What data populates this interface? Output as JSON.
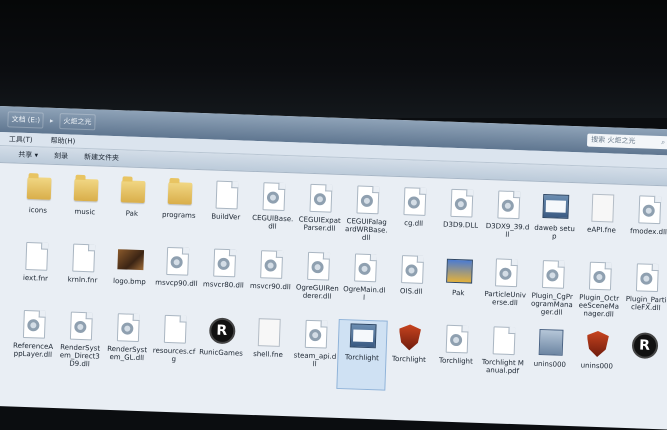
{
  "address": {
    "crumbs": [
      "文档 (E:)",
      "火炬之光"
    ],
    "separator": "▸"
  },
  "search": {
    "placeholder": "搜索 火炬之光"
  },
  "menu": {
    "items": [
      "工具(T)",
      "帮助(H)"
    ]
  },
  "toolbar": {
    "items": [
      "共享 ▾",
      "刻录",
      "新建文件夹"
    ]
  },
  "files": [
    {
      "name": "icons",
      "icon": "folder-icon"
    },
    {
      "name": "music",
      "icon": "folder-icon"
    },
    {
      "name": "Pak",
      "icon": "folder-icon"
    },
    {
      "name": "programs",
      "icon": "folder-icon"
    },
    {
      "name": "BuildVer",
      "icon": "file-icon"
    },
    {
      "name": "CEGUIBase.dll",
      "icon": "dll-icon"
    },
    {
      "name": "CEGUIExpatParser.dll",
      "icon": "dll-icon"
    },
    {
      "name": "CEGUIFalagardWRBase.dll",
      "icon": "dll-icon"
    },
    {
      "name": "cg.dll",
      "icon": "dll-icon"
    },
    {
      "name": "D3D9.DLL",
      "icon": "dll-icon"
    },
    {
      "name": "D3DX9_39.dll",
      "icon": "dll-icon"
    },
    {
      "name": "daweb setup",
      "icon": "exe-icon"
    },
    {
      "name": "eAPI.fne",
      "icon": "fne-icon"
    },
    {
      "name": "fmodex.dll",
      "icon": "dll-icon"
    },
    {
      "name": "iext.fnr",
      "icon": "file-icon"
    },
    {
      "name": "krnln.fnr",
      "icon": "file-icon"
    },
    {
      "name": "logo.bmp",
      "icon": "bmp-icon"
    },
    {
      "name": "msvcp90.dll",
      "icon": "dll-icon"
    },
    {
      "name": "msvcr80.dll",
      "icon": "dll-icon"
    },
    {
      "name": "msvcr90.dll",
      "icon": "dll-icon"
    },
    {
      "name": "OgreGUIRenderer.dll",
      "icon": "dll-icon"
    },
    {
      "name": "OgreMain.dll",
      "icon": "dll-icon"
    },
    {
      "name": "OIS.dll",
      "icon": "dll-icon"
    },
    {
      "name": "Pak",
      "icon": "archive-icon"
    },
    {
      "name": "ParticleUniverse.dll",
      "icon": "dll-icon"
    },
    {
      "name": "Plugin_CgProgramManager.dll",
      "icon": "dll-icon"
    },
    {
      "name": "Plugin_OctreeSceneManager.dll",
      "icon": "dll-icon"
    },
    {
      "name": "Plugin_ParticleFX.dll",
      "icon": "dll-icon"
    },
    {
      "name": "ReferenceAppLayer.dll",
      "icon": "dll-icon"
    },
    {
      "name": "RenderSystem_Direct3D9.dll",
      "icon": "dll-icon"
    },
    {
      "name": "RenderSystem_GL.dll",
      "icon": "dll-icon"
    },
    {
      "name": "resources.cfg",
      "icon": "file-icon"
    },
    {
      "name": "RunicGames",
      "icon": "runic-icon"
    },
    {
      "name": "shell.fne",
      "icon": "fne-icon"
    },
    {
      "name": "steam_api.dll",
      "icon": "dll-icon"
    },
    {
      "name": "Torchlight",
      "icon": "exe-icon"
    },
    {
      "name": "Torchlight",
      "icon": "torchlight-icon"
    },
    {
      "name": "Torchlight",
      "icon": "dll-icon"
    },
    {
      "name": "Torchlight Manual.pdf",
      "icon": "file-icon"
    },
    {
      "name": "unins000",
      "icon": "unins-icon"
    },
    {
      "name": "unins000",
      "icon": "torchlight-icon"
    },
    {
      "name": "",
      "icon": "runic-icon"
    }
  ]
}
